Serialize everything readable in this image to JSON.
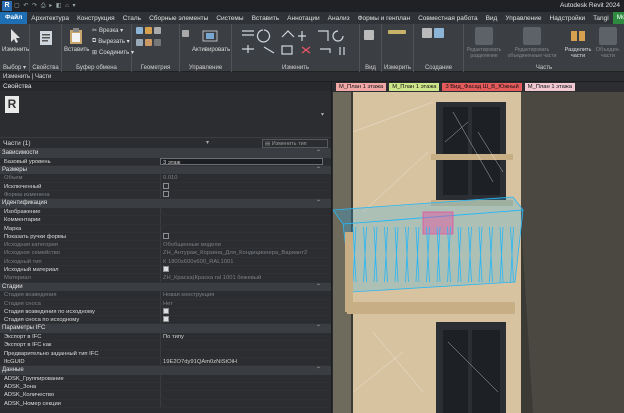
{
  "app": {
    "title": "Autodesk Revit 2024",
    "logo": "R"
  },
  "menu": {
    "file": "Файл",
    "tabs": [
      "Архитектура",
      "Конструкция",
      "Сталь",
      "Сборные элементы",
      "Системы",
      "Вставить",
      "Аннотации",
      "Анализ",
      "Формы и генплан",
      "Совместная работа",
      "Вид",
      "Управление",
      "Надстройки",
      "Tangl",
      "ModPlus"
    ]
  },
  "ribbon": {
    "select": {
      "modify": "Изменить",
      "select_label": "Выбор ▾"
    },
    "properties": {
      "label": "Свойства"
    },
    "clipboard": {
      "paste": "Вставить",
      "label": "Буфер обмена",
      "cut_notch": "Врезка ▾",
      "cut": "Вырезать ▾",
      "join": "Соединить ▾"
    },
    "geometry": {
      "label": "Геометрия"
    },
    "control": {
      "activate": "Активировать",
      "label": "Управление"
    },
    "modify": {
      "label": "Изменить"
    },
    "view": {
      "label": "Вид"
    },
    "measure": {
      "label": "Измерить"
    },
    "create": {
      "label": "Создание"
    },
    "parts": {
      "edit_division": "Редактировать разделение",
      "edit_merged": "Редактировать объединенные части",
      "divide": "Разделить части",
      "merge": "Объедин. части",
      "label": "Часть"
    }
  },
  "breadcrumb": "Изменить | Части",
  "properties_panel": {
    "title": "Свойства",
    "type_selector": "Части (1)",
    "edit_type": "Изменить тип",
    "categories": [
      {
        "name": "Зависимости",
        "rows": [
          {
            "key": "Базовый уровень",
            "value": "3 этаж",
            "boxed": true
          }
        ]
      },
      {
        "name": "Размеры",
        "rows": [
          {
            "key": "Объем",
            "value": "0.010",
            "dim": true
          },
          {
            "key": "Исключенный",
            "value": "",
            "check": "off"
          },
          {
            "key": "Форма изменена",
            "value": "",
            "check": "off",
            "dim": true
          }
        ]
      },
      {
        "name": "Идентификация",
        "rows": [
          {
            "key": "Изображение",
            "value": ""
          },
          {
            "key": "Комментарии",
            "value": ""
          },
          {
            "key": "Марка",
            "value": ""
          },
          {
            "key": "Показать ручки формы",
            "value": "",
            "check": "off"
          },
          {
            "key": "Исходная категория",
            "value": "Обобщенные модели",
            "dim": true
          },
          {
            "key": "Исходное семейство",
            "value": "ZH_Антураж_Корзина_Для_Кондиционера_Вариант2",
            "dim": true
          },
          {
            "key": "Исходный тип",
            "value": "К 1800х600х600_RAL1001",
            "dim": true
          },
          {
            "key": "Исходный материал",
            "value": "",
            "check": "on"
          },
          {
            "key": "Материал",
            "value": "ZH_Краска(Краска ral 1001 бежевый",
            "dim": true
          }
        ]
      },
      {
        "name": "Стадии",
        "rows": [
          {
            "key": "Стадия возведения",
            "value": "Новая конструкция",
            "dim": true
          },
          {
            "key": "Стадия сноса",
            "value": "Нет",
            "dim": true
          },
          {
            "key": "Стадия возведения по исходному",
            "value": "",
            "check": "on"
          },
          {
            "key": "Стадия сноса по исходному",
            "value": "",
            "check": "on"
          }
        ]
      },
      {
        "name": "Параметры IFC",
        "rows": [
          {
            "key": "Экспорт в IFC",
            "value": "По типу"
          },
          {
            "key": "Экспорт в IFC как",
            "value": ""
          },
          {
            "key": "Предварительно заданный тип IFC",
            "value": ""
          },
          {
            "key": "IfcGUID",
            "value": "19E2O7dy91QAm0zNiStOiH"
          }
        ]
      },
      {
        "name": "Данные",
        "rows": [
          {
            "key": "ADSK_Группирование",
            "value": ""
          },
          {
            "key": "ADSK_Зона",
            "value": ""
          },
          {
            "key": "ADSK_Количество",
            "value": ""
          },
          {
            "key": "ADSK_Номер секции",
            "value": ""
          }
        ]
      }
    ]
  },
  "view_tabs": [
    {
      "label": "М_План 1 этажа",
      "color": "#f2a7a7"
    },
    {
      "label": "М_План 1 этажа",
      "color": "#cde68a"
    },
    {
      "label": "3 Вид_Фасад Ш_В_Южный",
      "color": "#e55a5a"
    },
    {
      "label": "М_План 1 этажа",
      "color": "#f2c9d3"
    }
  ],
  "colors": {
    "accent": "#1f6fb5",
    "selection": "#29b6f6",
    "facade": "#d8c3a0"
  }
}
